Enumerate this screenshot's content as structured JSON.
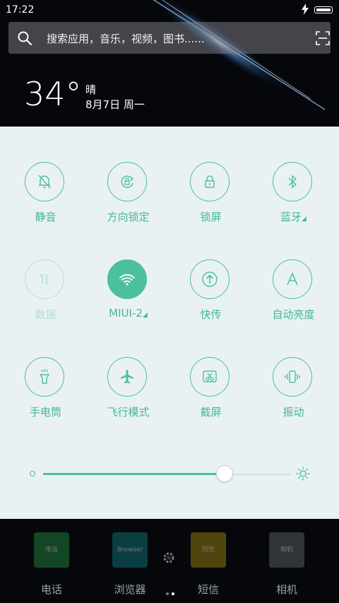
{
  "status_bar": {
    "time": "17:22"
  },
  "search": {
    "placeholder": "搜索应用，音乐，视频，图书......"
  },
  "weather": {
    "temperature": "34°",
    "condition": "晴",
    "date": "8月7日 周一"
  },
  "quick_settings": {
    "toggles": [
      {
        "label": "静音",
        "icon": "bell-off-icon",
        "state": "off"
      },
      {
        "label": "方向锁定",
        "icon": "rotation-lock-icon",
        "state": "off"
      },
      {
        "label": "锁屏",
        "icon": "lock-icon",
        "state": "off"
      },
      {
        "label": "蓝牙",
        "icon": "bluetooth-icon",
        "state": "off"
      },
      {
        "label": "数据",
        "icon": "mobile-data-icon",
        "state": "disabled"
      },
      {
        "label": "MIUI-2",
        "icon": "wifi-icon",
        "state": "on"
      },
      {
        "label": "快传",
        "icon": "transfer-icon",
        "state": "off"
      },
      {
        "label": "自动亮度",
        "icon": "auto-brightness-icon",
        "state": "off"
      },
      {
        "label": "手电筒",
        "icon": "flashlight-icon",
        "state": "off"
      },
      {
        "label": "飞行模式",
        "icon": "airplane-icon",
        "state": "off"
      },
      {
        "label": "截屏",
        "icon": "screenshot-icon",
        "state": "off"
      },
      {
        "label": "振动",
        "icon": "vibrate-icon",
        "state": "off"
      }
    ],
    "brightness": 0.735
  },
  "dock": [
    {
      "name": "电话",
      "icon_text": "电话",
      "color": "#1f7a3c"
    },
    {
      "name": "浏览器",
      "icon_text": "Browser",
      "color": "#0f6b73"
    },
    {
      "name": "短信",
      "icon_text": "短信",
      "color": "#8a7a10"
    },
    {
      "name": "相机",
      "icon_text": "相机",
      "color": "#555a5e"
    }
  ],
  "colors": {
    "accent": "#4cbf9c",
    "panel_bg": "#eaf1f2"
  }
}
